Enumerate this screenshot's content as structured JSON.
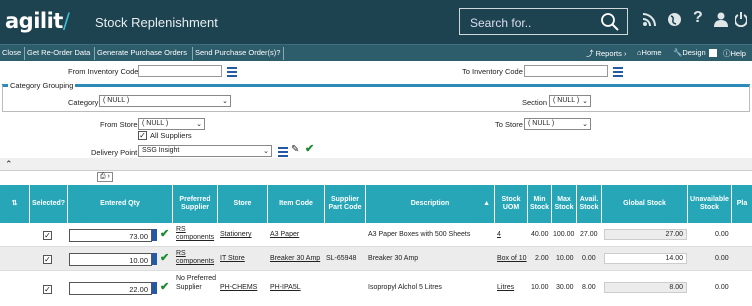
{
  "header": {
    "logo": "agilit",
    "title": "Stock Replenishment",
    "search_placeholder": "Search for.."
  },
  "toolbar": {
    "close": "Close",
    "get_reorder": "Get Re-Order Data",
    "generate_po": "Generate Purchase Orders",
    "send_po": "Send Purchase Order(s)?",
    "reports": "Reports",
    "home": "Home",
    "design": "Design",
    "help": "Help"
  },
  "filters": {
    "from_inventory_label": "From Inventory Code",
    "to_inventory_label": "To Inventory Code",
    "category_grouping": "Category Grouping",
    "category_label": "Category",
    "category_value": "( NULL )",
    "section_label": "Section",
    "section_value": "( NULL )",
    "from_store_label": "From Store",
    "from_store_value": "( NULL )",
    "all_suppliers": "All Suppliers",
    "to_store_label": "To Store",
    "to_store_value": "( NULL )",
    "delivery_point_label": "Delivery Point",
    "delivery_point_value": "SSG Insight"
  },
  "grid": {
    "columns": [
      "Selected?",
      "Entered Qty",
      "Preferred Supplier",
      "Store",
      "Item Code",
      "Supplier Part Code",
      "Description",
      "Stock UOM",
      "Min Stock",
      "Max Stock",
      "Avail. Stock",
      "Global Stock",
      "Unavailable Stock",
      "Pla"
    ],
    "rows": [
      {
        "qty": "73.00",
        "supplier": "RS components",
        "store": "Stationery",
        "item_code": "A3 Paper",
        "part_code": "",
        "description": "A3 Paper Boxes with 500 Sheets",
        "uom": "4",
        "min": "40.00",
        "max": "100.00",
        "avail": "27.00",
        "global": "27.00",
        "unavail": "0.00"
      },
      {
        "qty": "10.00",
        "supplier": "RS components",
        "store": "IT Store",
        "item_code": "Breaker 30 Amp",
        "part_code": "SL-65948",
        "description": "Breaker 30 Amp",
        "uom": "Box of 10",
        "min": "2.00",
        "max": "10.00",
        "avail": "0.00",
        "global": "14.00",
        "unavail": "0.00"
      },
      {
        "qty": "22.00",
        "supplier": "No Preferred Supplier",
        "store": "PH-CHEMS",
        "item_code": "PH-IPA5L",
        "part_code": "",
        "description": "Isopropyl Alchol 5 Litres",
        "uom": "Litres",
        "min": "10.00",
        "max": "30.00",
        "avail": "8.00",
        "global": "8.00",
        "unavail": "0.00"
      }
    ]
  },
  "colors": {
    "header_bg": "#1d4350",
    "toolbar_bg": "#2d5c6b",
    "grid_header": "#27a6b8",
    "accent": "#2b8ab8"
  }
}
